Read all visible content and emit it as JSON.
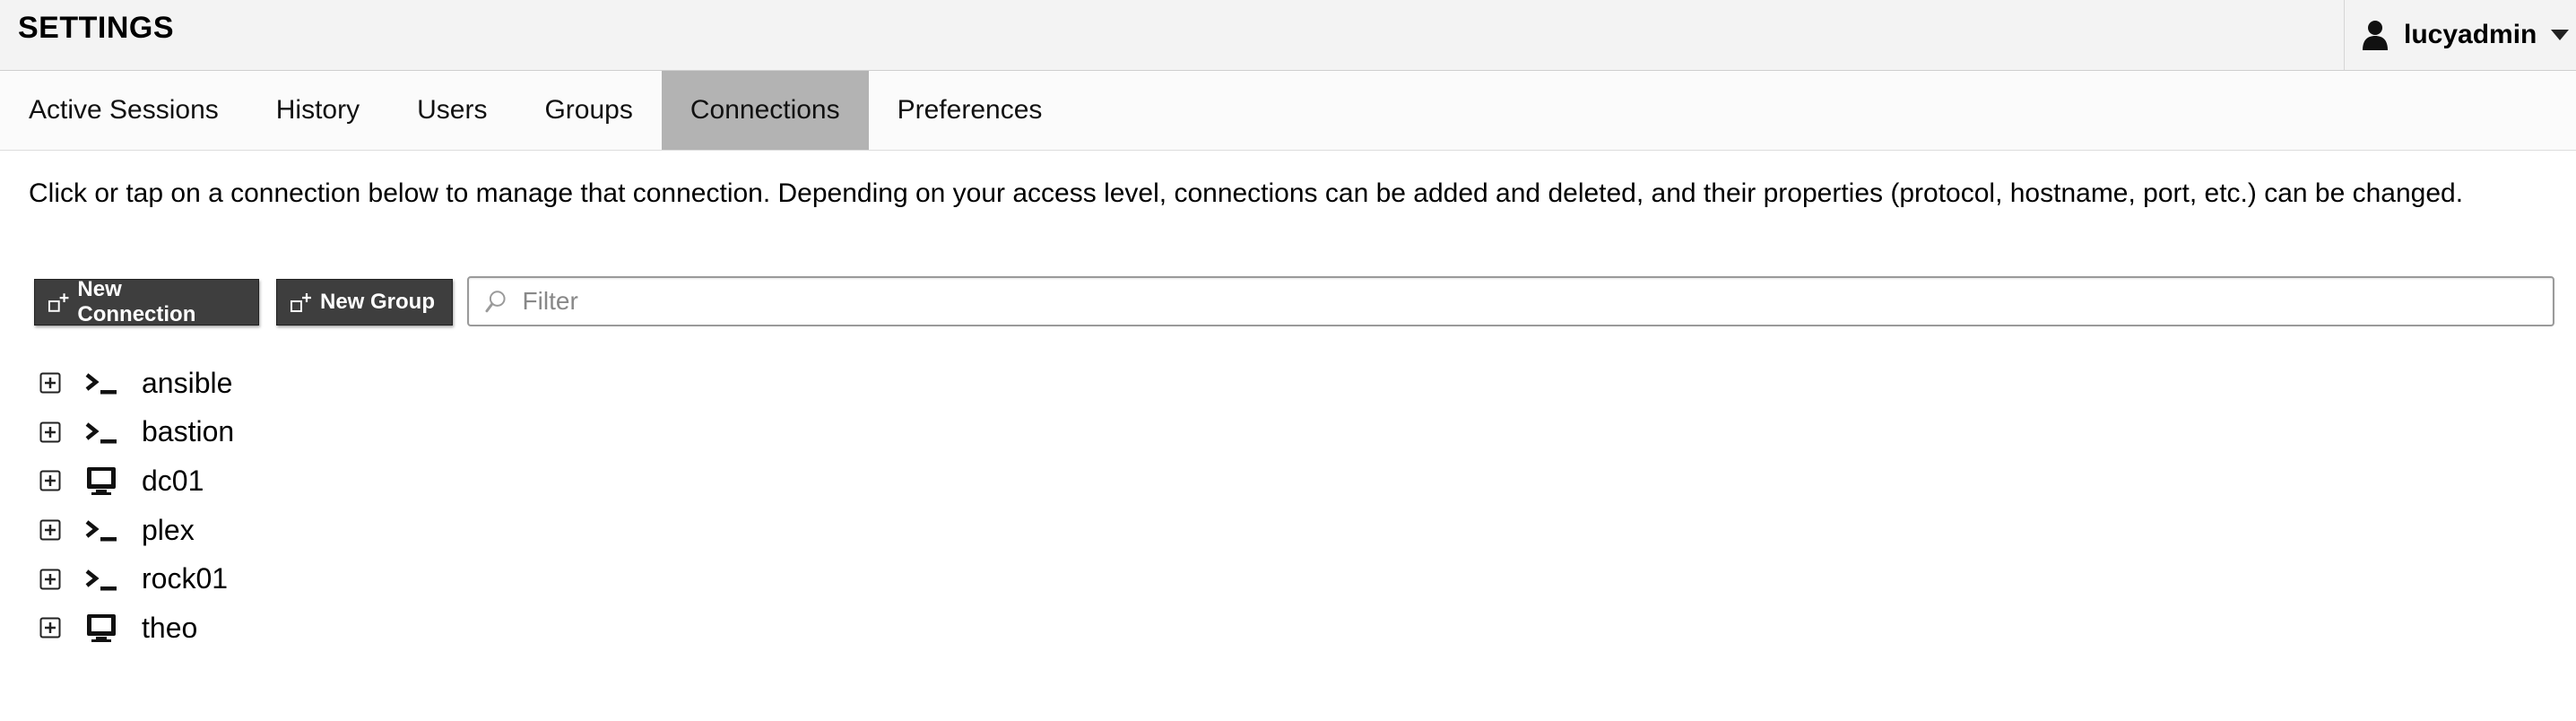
{
  "header": {
    "title": "SETTINGS",
    "user": {
      "name": "lucyadmin",
      "icon": "user-icon"
    }
  },
  "tabs": [
    {
      "label": "Active Sessions",
      "active": false
    },
    {
      "label": "History",
      "active": false
    },
    {
      "label": "Users",
      "active": false
    },
    {
      "label": "Groups",
      "active": false
    },
    {
      "label": "Connections",
      "active": true
    },
    {
      "label": "Preferences",
      "active": false
    }
  ],
  "description": "Click or tap on a connection below to manage that connection. Depending on your access level, connections can be added and deleted, and their properties (protocol, hostname, port, etc.) can be changed.",
  "toolbar": {
    "new_connection_label": "New Connection",
    "new_group_label": "New Group",
    "filter_placeholder": "Filter",
    "filter_value": ""
  },
  "connections": [
    {
      "name": "ansible",
      "protocol_icon": "terminal-icon"
    },
    {
      "name": "bastion",
      "protocol_icon": "terminal-icon"
    },
    {
      "name": "dc01",
      "protocol_icon": "monitor-icon"
    },
    {
      "name": "plex",
      "protocol_icon": "terminal-icon"
    },
    {
      "name": "rock01",
      "protocol_icon": "terminal-icon"
    },
    {
      "name": "theo",
      "protocol_icon": "monitor-icon"
    }
  ],
  "colors": {
    "header_bg": "#f3f3f3",
    "tab_active_bg": "#b3b3b3",
    "button_bg": "#3e3e3e"
  }
}
